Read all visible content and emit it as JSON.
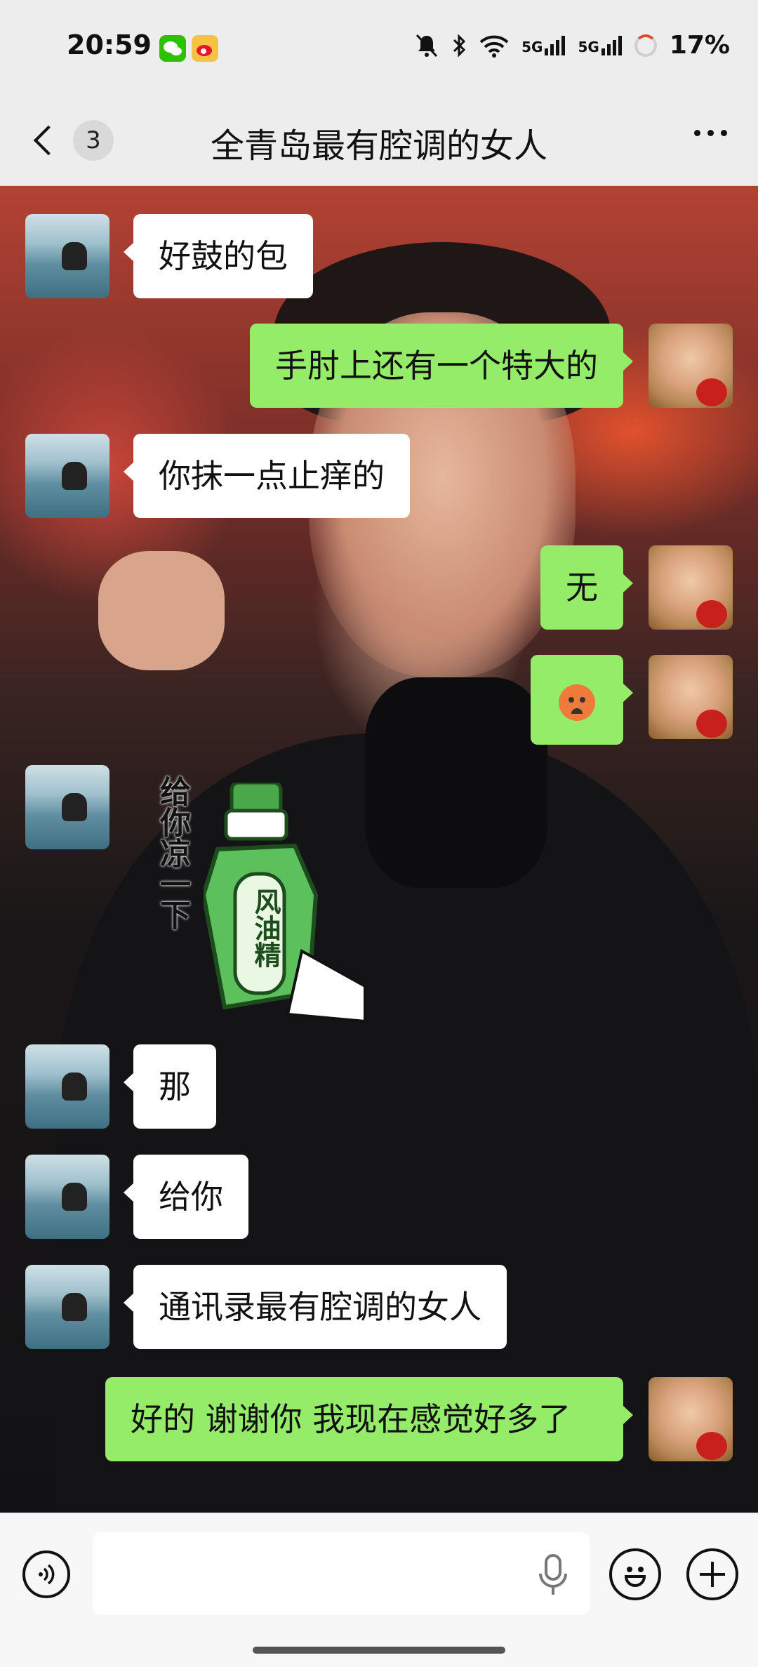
{
  "status_bar": {
    "time": "20:59",
    "apps": [
      "wechat-icon",
      "weibo-icon"
    ],
    "icons": [
      "mute-bell-icon",
      "bluetooth-icon",
      "wifi-icon",
      "5g-signal-icon",
      "5g-signal-icon",
      "battery-ring-icon"
    ],
    "net1": "5G",
    "net2": "5G",
    "battery": "17%"
  },
  "header": {
    "unread_count": "3",
    "title": "全青岛最有腔调的女人",
    "icons": {
      "back": "back-chevron-icon",
      "more": "more-dots-icon"
    }
  },
  "messages": [
    {
      "side": "in",
      "text": "好鼓的包"
    },
    {
      "side": "out",
      "text": "手肘上还有一个特大的"
    },
    {
      "side": "in",
      "text": "你抹一点止痒的"
    },
    {
      "side": "out",
      "text": "无"
    },
    {
      "side": "out",
      "emoji": "hot-face-emoji"
    },
    {
      "side": "in",
      "sticker": {
        "caption": "给你凉一下",
        "label": "风油精"
      }
    },
    {
      "side": "in",
      "text": "那"
    },
    {
      "side": "in",
      "text": "给你"
    },
    {
      "side": "in",
      "text": "通讯录最有腔调的女人"
    },
    {
      "side": "out",
      "text": "好的  谢谢你  我现在感觉好多了"
    }
  ],
  "input_bar": {
    "placeholder": "",
    "icons": [
      "voice-icon",
      "microphone-icon",
      "emoji-icon",
      "plus-icon"
    ]
  },
  "colors": {
    "outgoing_bubble": "#95ec69",
    "incoming_bubble": "#ffffff",
    "wechat_green": "#2dc100"
  }
}
